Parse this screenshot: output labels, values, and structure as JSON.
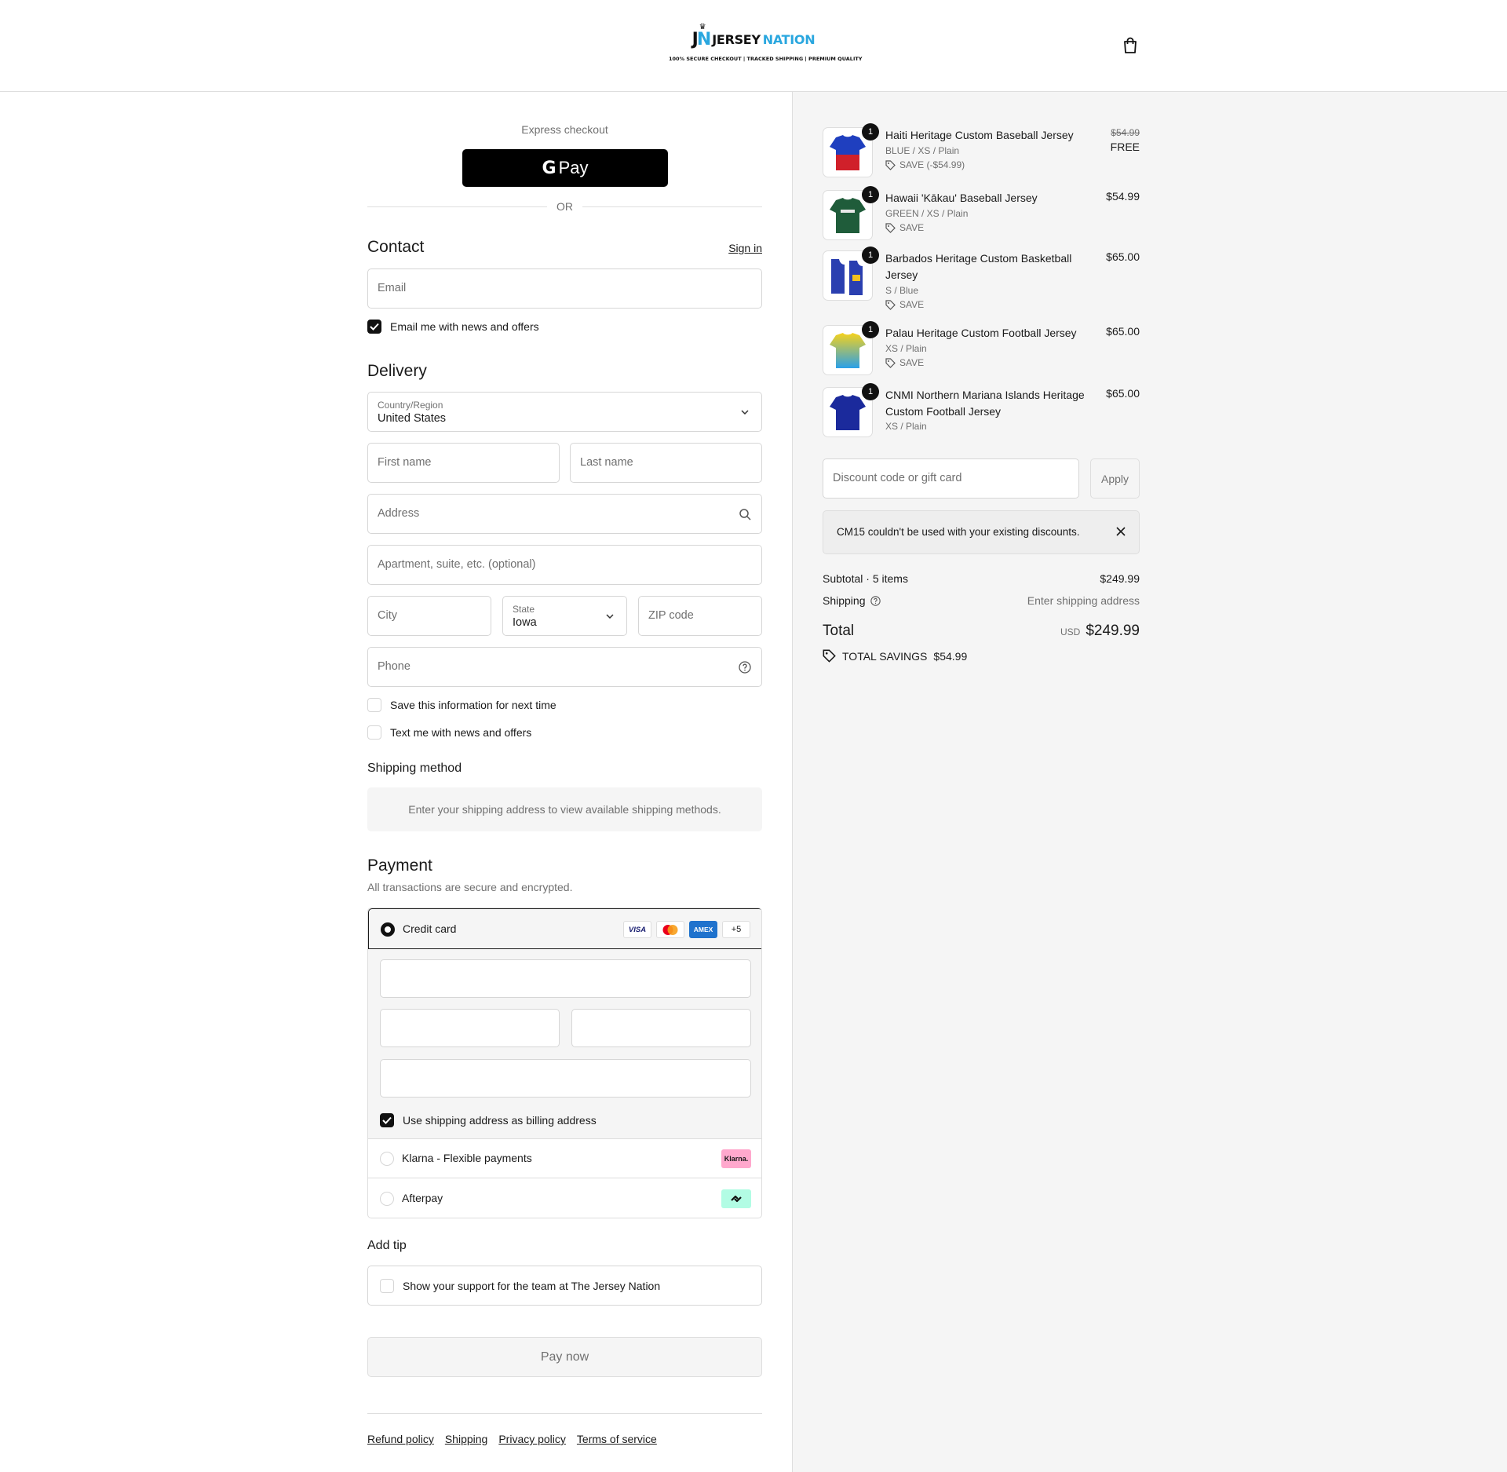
{
  "header": {
    "logo_mark_j": "J",
    "logo_mark_n": "N",
    "logo_jersey": "JERSEY",
    "logo_nation": "NATION",
    "tagline": "100% SECURE CHECKOUT | TRACKED SHIPPING | PREMIUM QUALITY",
    "cart_icon": "bag-icon"
  },
  "express": {
    "label": "Express checkout",
    "gpay_g": "G",
    "gpay_pay": "Pay",
    "or": "OR"
  },
  "contact": {
    "title": "Contact",
    "sign_in": "Sign in",
    "email_placeholder": "Email",
    "news_label": "Email me with news and offers",
    "news_checked": true
  },
  "delivery": {
    "title": "Delivery",
    "country_label": "Country/Region",
    "country_value": "United States",
    "first_name": "First name",
    "last_name": "Last name",
    "address": "Address",
    "apartment": "Apartment, suite, etc. (optional)",
    "city": "City",
    "state_label": "State",
    "state_value": "Iowa",
    "zip": "ZIP code",
    "phone": "Phone",
    "save_info": "Save this information for next time",
    "text_me": "Text me with news and offers"
  },
  "shipping_method": {
    "title": "Shipping method",
    "notice": "Enter your shipping address to view available shipping methods."
  },
  "payment": {
    "title": "Payment",
    "subtitle": "All transactions are secure and encrypted.",
    "credit_card": "Credit card",
    "card_brands": [
      "VISA",
      "mastercard",
      "AMEX",
      "+5"
    ],
    "billing_same": "Use shipping address as billing address",
    "klarna": "Klarna - Flexible payments",
    "klarna_badge": "Klarna.",
    "afterpay": "Afterpay"
  },
  "tip": {
    "title": "Add tip",
    "label": "Show your support for the team at The Jersey Nation"
  },
  "pay_now": "Pay now",
  "footer": {
    "links": [
      "Refund policy",
      "Shipping",
      "Privacy policy",
      "Terms of service"
    ]
  },
  "summary": {
    "items": [
      {
        "qty": "1",
        "name": "Haiti Heritage Custom Baseball Jersey",
        "variant": "BLUE / XS / Plain",
        "save": "SAVE (-$54.99)",
        "price_original": "$54.99",
        "price": "FREE",
        "colors": [
          "#1f3fbf",
          "#d0202a"
        ]
      },
      {
        "qty": "1",
        "name": "Hawaii 'Kākau' Baseball Jersey",
        "variant": "GREEN / XS / Plain",
        "save": "SAVE",
        "price": "$54.99",
        "colors": [
          "#1f5c3a",
          "#1f5c3a"
        ]
      },
      {
        "qty": "1",
        "name": "Barbados Heritage Custom Basketball Jersey",
        "variant": "S / Blue",
        "save": "SAVE",
        "price": "$65.00",
        "colors": [
          "#2a3fb0",
          "#f2c01e"
        ]
      },
      {
        "qty": "1",
        "name": "Palau Heritage Custom Football Jersey",
        "variant": "XS / Plain",
        "save": "SAVE",
        "price": "$65.00",
        "colors": [
          "#f7d21a",
          "#2aa0e8"
        ]
      },
      {
        "qty": "1",
        "name": "CNMI Northern Mariana Islands Heritage Custom Football Jersey",
        "variant": "XS / Plain",
        "price": "$65.00",
        "colors": [
          "#1b2a9c",
          "#1b2a9c"
        ]
      }
    ],
    "discount_placeholder": "Discount code or gift card",
    "apply": "Apply",
    "error": "CM15 couldn't be used with your existing discounts.",
    "subtotal_label": "Subtotal · 5 items",
    "subtotal_value": "$249.99",
    "shipping_label": "Shipping",
    "shipping_value": "Enter shipping address",
    "total_label": "Total",
    "currency": "USD",
    "total_value": "$249.99",
    "savings_label": "TOTAL SAVINGS",
    "savings_value": "$54.99"
  }
}
